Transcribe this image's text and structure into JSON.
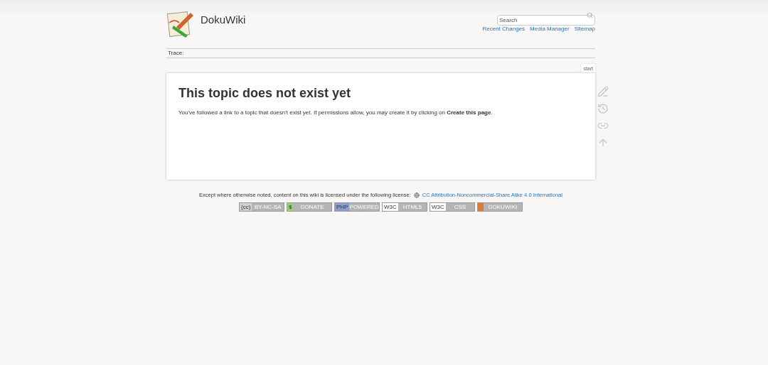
{
  "header": {
    "title": "DokuWiki",
    "search": {
      "placeholder": "Search"
    },
    "links": [
      "Recent Changes",
      "Media Manager",
      "Sitemap"
    ]
  },
  "breadcrumbs": {
    "label": "Trace:"
  },
  "page": {
    "tab": "start",
    "heading": "This topic does not exist yet",
    "text": "You've followed a link to a topic that doesn't exist yet. If permissions allow, you may create it by clicking on **Create this page**."
  },
  "page_tools": [
    {
      "kind": "edit"
    },
    {
      "kind": "history"
    },
    {
      "kind": "link"
    },
    {
      "kind": "top"
    }
  ],
  "footer": {
    "license_text": "Except where otherwise noted, content on this wiki is licensed under the following license:",
    "license_link": "CC Attribution-Noncommercial-Share Alike 4.0 International",
    "badges": [
      {
        "left": "(cc)",
        "right": "BY-NC-SA",
        "color": "#d0d0d0"
      },
      {
        "left": "$",
        "right": "DONATE",
        "color": "#9ad27a"
      },
      {
        "left": "PHP",
        "right": "POWERED",
        "color": "#8b9fd0"
      },
      {
        "left": "W3C",
        "right": "HTML5",
        "color": "#ffffff"
      },
      {
        "left": "W3C",
        "right": "CSS",
        "color": "#ffffff"
      },
      {
        "right": "DOKUWIKI",
        "color": "#e07a3a"
      }
    ]
  }
}
